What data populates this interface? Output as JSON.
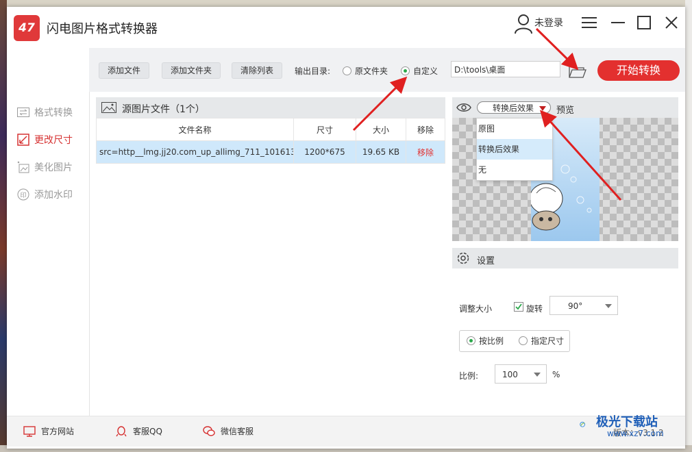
{
  "app": {
    "title": "闪电图片格式转换器",
    "logo_text": "47",
    "login": "未登录",
    "accent_color": "#e3302f"
  },
  "nav": [
    {
      "label": "格式转换",
      "icon": "convert-icon"
    },
    {
      "label": "更改尺寸",
      "icon": "resize-icon"
    },
    {
      "label": "美化图片",
      "icon": "beautify-icon"
    },
    {
      "label": "添加水印",
      "icon": "watermark-icon"
    }
  ],
  "toolbar": {
    "add_file": "添加文件",
    "add_folder": "添加文件夹",
    "clear_list": "清除列表",
    "output_label": "输出目录:",
    "option_original": "原文件夹",
    "option_custom": "自定义",
    "selected_option": "自定义",
    "output_path": "D:\\tools\\桌面",
    "start_button": "开始转换"
  },
  "files": {
    "header": "源图片文件（1个）",
    "columns": [
      "文件名称",
      "尺寸",
      "大小",
      "移除"
    ],
    "rows": [
      {
        "name": "src=http__lmg.jj20.com_up_allimg_711_101613...",
        "dimensions": "1200*675",
        "size": "19.65 KB",
        "remove": "移除"
      }
    ]
  },
  "preview": {
    "selected_effect": "转换后效果",
    "label": "预览",
    "options": [
      "原图",
      "转换后效果",
      "无"
    ]
  },
  "settings": {
    "title": "设置",
    "resize_label": "调整大小",
    "rotate_label": "旋转",
    "rotate_checked": true,
    "rotate_value": "90°",
    "mode_ratio": "按比例",
    "mode_fixed": "指定尺寸",
    "selected_mode": "按比例",
    "ratio_label": "比例:",
    "ratio_value": "100",
    "ratio_unit": "%"
  },
  "footer": {
    "website": "官方网站",
    "qq": "客服QQ",
    "wechat": "微信客服",
    "version": "版本：v3.1.2"
  },
  "watermark": {
    "top": "极光下载站",
    "bottom": "www.xz7.com"
  }
}
